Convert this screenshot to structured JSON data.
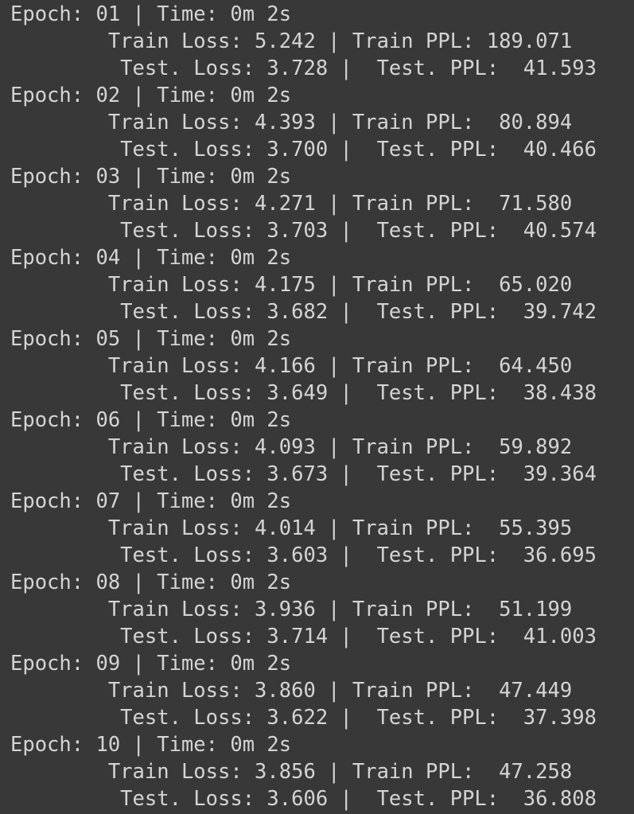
{
  "log": {
    "lines": [
      "Epoch: 01 | Time: 0m 2s",
      "\tTrain Loss: 5.242 | Train PPL: 189.071",
      "\t Test. Loss: 3.728 |  Test. PPL:  41.593",
      "Epoch: 02 | Time: 0m 2s",
      "\tTrain Loss: 4.393 | Train PPL:  80.894",
      "\t Test. Loss: 3.700 |  Test. PPL:  40.466",
      "Epoch: 03 | Time: 0m 2s",
      "\tTrain Loss: 4.271 | Train PPL:  71.580",
      "\t Test. Loss: 3.703 |  Test. PPL:  40.574",
      "Epoch: 04 | Time: 0m 2s",
      "\tTrain Loss: 4.175 | Train PPL:  65.020",
      "\t Test. Loss: 3.682 |  Test. PPL:  39.742",
      "Epoch: 05 | Time: 0m 2s",
      "\tTrain Loss: 4.166 | Train PPL:  64.450",
      "\t Test. Loss: 3.649 |  Test. PPL:  38.438",
      "Epoch: 06 | Time: 0m 2s",
      "\tTrain Loss: 4.093 | Train PPL:  59.892",
      "\t Test. Loss: 3.673 |  Test. PPL:  39.364",
      "Epoch: 07 | Time: 0m 2s",
      "\tTrain Loss: 4.014 | Train PPL:  55.395",
      "\t Test. Loss: 3.603 |  Test. PPL:  36.695",
      "Epoch: 08 | Time: 0m 2s",
      "\tTrain Loss: 3.936 | Train PPL:  51.199",
      "\t Test. Loss: 3.714 |  Test. PPL:  41.003",
      "Epoch: 09 | Time: 0m 2s",
      "\tTrain Loss: 3.860 | Train PPL:  47.449",
      "\t Test. Loss: 3.622 |  Test. PPL:  37.398",
      "Epoch: 10 | Time: 0m 2s",
      "\tTrain Loss: 3.856 | Train PPL:  47.258",
      "\t Test. Loss: 3.606 |  Test. PPL:  36.808"
    ]
  }
}
